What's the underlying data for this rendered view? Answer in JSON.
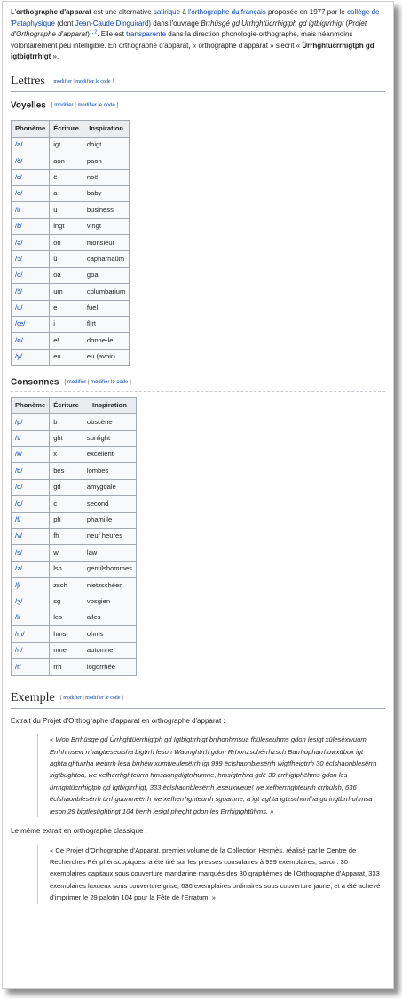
{
  "intro": {
    "title_bold": "orthographe d'apparat",
    "seg1": "L'",
    "seg2": " est une alternative ",
    "link_satirique": "satirique",
    "seg3": " à ",
    "link_orthographe": "l'orthographe du français",
    "seg4": " proposée en 1977 par le ",
    "link_college": "collège de 'Pataphysique",
    "seg5": " (dont ",
    "link_jean": "Jean-Caude Dinguirard",
    "seg6": ") dans l'ouvrage ",
    "work_title": "Brrhüsgé gd Ürrhghtücrrhigtph gd igtbigtrrhigt",
    "seg7": " (",
    "work_translation": "Projet d'Orthographe d'apparat",
    "seg8": ")",
    "refs": "1, 2",
    "seg9": ". Elle est ",
    "link_transparente": "transparente",
    "seg10": " dans la direction phonologie-orthographe, mais néanmoins volontairement peu intelligible. En orthographe d'apparat, « orthographe d'apparat » s'écrit « ",
    "self_name": "Ürrhghtücrrhigtph gd igtbigtrrhigt",
    "seg11": " »."
  },
  "edit": {
    "bracket_open": "[",
    "modifier": "modifier",
    "sep": " | ",
    "modifier_code": "modifier le code",
    "bracket_close": "]"
  },
  "lettres": {
    "heading": "Lettres"
  },
  "voyelles": {
    "heading": "Voyelles",
    "headers": [
      "Phonème",
      "Écriture",
      "Inspiration"
    ],
    "rows": [
      [
        "/a/",
        "igt",
        "doigt"
      ],
      [
        "/ɑ̃/",
        "aon",
        "paon"
      ],
      [
        "/ɛ/",
        "ë",
        "noël"
      ],
      [
        "/e/",
        "a",
        "baby"
      ],
      [
        "/i/",
        "u",
        "business"
      ],
      [
        "/ɛ̃/",
        "ingt",
        "vingt"
      ],
      [
        "/ə/",
        "on",
        "monsieur"
      ],
      [
        "/ɔ/",
        "û",
        "capharnaüm"
      ],
      [
        "/o/",
        "oa",
        "goal"
      ],
      [
        "/ɔ̃/",
        "um",
        "columbarium"
      ],
      [
        "/u/",
        "e",
        "fuel"
      ],
      [
        "/œ/",
        "i",
        "flirt"
      ],
      [
        "/ø/",
        "e!",
        "donne-le!"
      ],
      [
        "/y/",
        "eu",
        "eu (avoir)"
      ]
    ]
  },
  "consonnes": {
    "heading": "Consonnes",
    "headers": [
      "Phonème",
      "Écriture",
      "Inspiration"
    ],
    "rows": [
      [
        "/p/",
        "b",
        "obscène"
      ],
      [
        "/t/",
        "ght",
        "sunlight"
      ],
      [
        "/k/",
        "x",
        "excellent"
      ],
      [
        "/b/",
        "bes",
        "lombes"
      ],
      [
        "/d/",
        "gd",
        "amygdale"
      ],
      [
        "/g/",
        "c",
        "second"
      ],
      [
        "/f/",
        "ph",
        "phamille"
      ],
      [
        "/v/",
        "fh",
        "neuf heures"
      ],
      [
        "/s/",
        "w",
        "law"
      ],
      [
        "/z/",
        "lsh",
        "gentilshommes"
      ],
      [
        "/ʃ/",
        "zsch",
        "nietzschéen"
      ],
      [
        "/ʒ/",
        "sg",
        "vosgien"
      ],
      [
        "/l/",
        "les",
        "ailes"
      ],
      [
        "/m/",
        "hms",
        "ohms"
      ],
      [
        "/n/",
        "mne",
        "automne"
      ],
      [
        "/r/",
        "rrh",
        "logorrhée"
      ]
    ]
  },
  "exemple": {
    "heading": "Exemple",
    "intro1": "Extrait du Projet d'Orthographe d'apparat en orthographe d'apparat :",
    "quote1": "« Won Brrhüsge gd Ürrhghtüerrhigtph gd Igtbigtrrhigt brrhonhmsua fhüleseuhms gdon lesigt xüleséxwuum Errhhmsew rrhaigtleseulsha bigtrrh leson Waonghtrrh gdon Rrhonzschérrhzsch Barrhupharrhuwxübux igt aghta ghturrha weurrh lesa brrhëw xumweulesërrh igt 999 ëclshaonblesërrh wigtfheigtrrh 30 ëclshaonblesërrh xigtbughtoa, we xefherrhghteurrh hmsaongdigtrrhumne, hmsigtrrhxa gdë 30 crrhigtphëhms gdon les ürrhghtücrrhigtph gd Igtbigtrrhigt, 333 ëclshaonblesërrh leseuxweue! we xefherrhghteurrh crrhulsh, 636 ëclshaonblesërrh ürrhgdumneërrh we xefherrhghteurrh sgoamne, a igt aghta igtzschonfha gd ingtbrrhuhmsa leson 29 bigtlesüghtingt 104 berrh lesigt pheght gdon les Errhigtghtühms. »",
    "intro2": "Le même extrait en orthographe classique :",
    "quote2": "« Ce Projet d'Orthographe d'Apparat, premier volume de la Collection Hermès, réalisé par le Centre de Recherches Périphériscopiques, a été tiré sur les presses consulaires à 999 exemplaires, savoir: 30 exemplaires capitaux sous couverture mandarine marqués des 30 graphèmes de l'Orthographe d'Apparat, 333 exemplaires luxueux sous couverture grise, 636 exemplaires ordinaires sous couverture jaune, et a été achevé d'imprimer le 29 palotin 104 pour la Fête de l'Erratum. »"
  }
}
